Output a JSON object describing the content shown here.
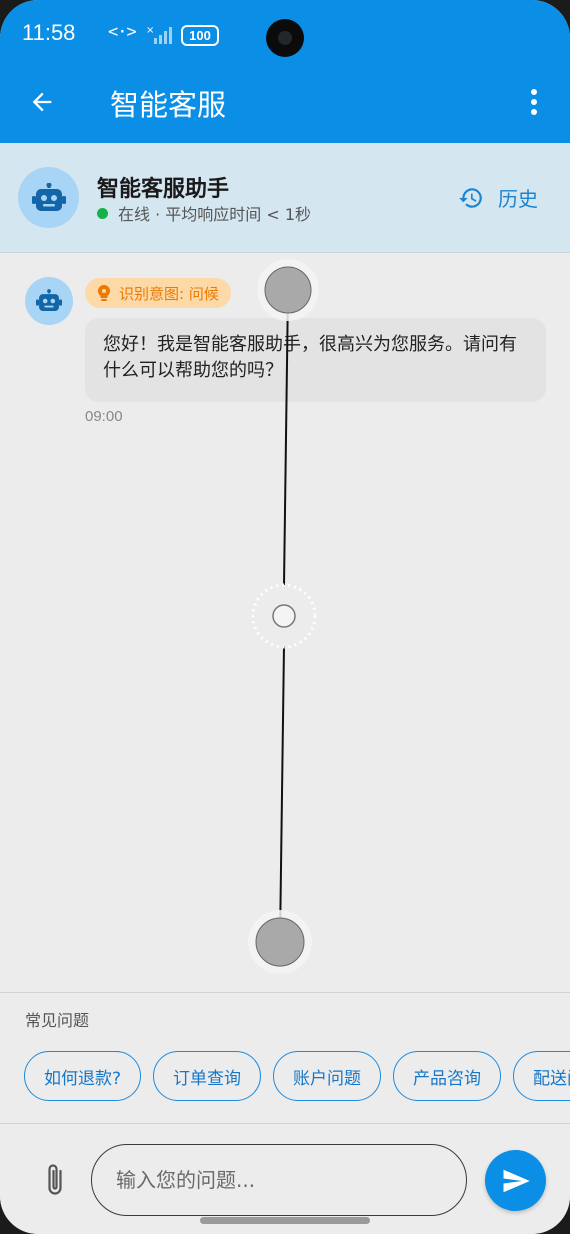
{
  "status_bar": {
    "time": "11:58",
    "network": "<·>",
    "battery": "100"
  },
  "app_bar": {
    "title": "智能客服",
    "back_icon": "arrow-left-icon",
    "more_icon": "more-vert-icon"
  },
  "assistant": {
    "name": "智能客服助手",
    "status": "在线 · 平均响应时间 < 1秒",
    "history_label": "历史",
    "avatar_icon": "robot-icon"
  },
  "messages": [
    {
      "intent_tag": "识别意图: 问候",
      "text": "您好！我是智能客服助手，很高兴为您服务。请问有什么可以帮助您的吗？",
      "time": "09:00"
    }
  ],
  "faq": {
    "title": "常见问题",
    "chips": [
      "如何退款?",
      "订单查询",
      "账户问题",
      "产品咨询",
      "配送问题"
    ]
  },
  "input": {
    "placeholder": "输入您的问题...",
    "value": ""
  },
  "colors": {
    "primary": "#0a8ee6",
    "header_bg": "#d4e6f0",
    "online": "#17b04a",
    "intent_bg": "#fdd9a8",
    "intent_text": "#ec7a00"
  }
}
